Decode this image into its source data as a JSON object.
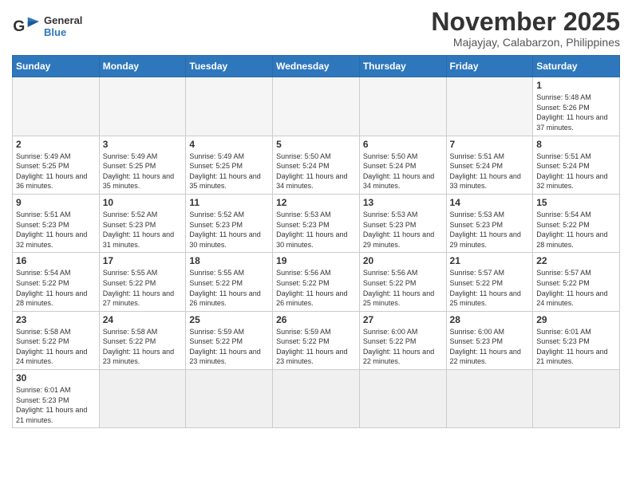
{
  "header": {
    "logo_line1": "General",
    "logo_line2": "Blue",
    "month_title": "November 2025",
    "location": "Majayjay, Calabarzon, Philippines"
  },
  "weekdays": [
    "Sunday",
    "Monday",
    "Tuesday",
    "Wednesday",
    "Thursday",
    "Friday",
    "Saturday"
  ],
  "weeks": [
    [
      {
        "day": null
      },
      {
        "day": null
      },
      {
        "day": null
      },
      {
        "day": null
      },
      {
        "day": null
      },
      {
        "day": null
      },
      {
        "day": 1,
        "sunrise": "5:48 AM",
        "sunset": "5:26 PM",
        "daylight": "11 hours and 37 minutes."
      }
    ],
    [
      {
        "day": 2,
        "sunrise": "5:49 AM",
        "sunset": "5:25 PM",
        "daylight": "11 hours and 36 minutes."
      },
      {
        "day": 3,
        "sunrise": "5:49 AM",
        "sunset": "5:25 PM",
        "daylight": "11 hours and 35 minutes."
      },
      {
        "day": 4,
        "sunrise": "5:49 AM",
        "sunset": "5:25 PM",
        "daylight": "11 hours and 35 minutes."
      },
      {
        "day": 5,
        "sunrise": "5:50 AM",
        "sunset": "5:24 PM",
        "daylight": "11 hours and 34 minutes."
      },
      {
        "day": 6,
        "sunrise": "5:50 AM",
        "sunset": "5:24 PM",
        "daylight": "11 hours and 34 minutes."
      },
      {
        "day": 7,
        "sunrise": "5:51 AM",
        "sunset": "5:24 PM",
        "daylight": "11 hours and 33 minutes."
      },
      {
        "day": 8,
        "sunrise": "5:51 AM",
        "sunset": "5:24 PM",
        "daylight": "11 hours and 32 minutes."
      }
    ],
    [
      {
        "day": 9,
        "sunrise": "5:51 AM",
        "sunset": "5:23 PM",
        "daylight": "11 hours and 32 minutes."
      },
      {
        "day": 10,
        "sunrise": "5:52 AM",
        "sunset": "5:23 PM",
        "daylight": "11 hours and 31 minutes."
      },
      {
        "day": 11,
        "sunrise": "5:52 AM",
        "sunset": "5:23 PM",
        "daylight": "11 hours and 30 minutes."
      },
      {
        "day": 12,
        "sunrise": "5:53 AM",
        "sunset": "5:23 PM",
        "daylight": "11 hours and 30 minutes."
      },
      {
        "day": 13,
        "sunrise": "5:53 AM",
        "sunset": "5:23 PM",
        "daylight": "11 hours and 29 minutes."
      },
      {
        "day": 14,
        "sunrise": "5:53 AM",
        "sunset": "5:23 PM",
        "daylight": "11 hours and 29 minutes."
      },
      {
        "day": 15,
        "sunrise": "5:54 AM",
        "sunset": "5:22 PM",
        "daylight": "11 hours and 28 minutes."
      }
    ],
    [
      {
        "day": 16,
        "sunrise": "5:54 AM",
        "sunset": "5:22 PM",
        "daylight": "11 hours and 28 minutes."
      },
      {
        "day": 17,
        "sunrise": "5:55 AM",
        "sunset": "5:22 PM",
        "daylight": "11 hours and 27 minutes."
      },
      {
        "day": 18,
        "sunrise": "5:55 AM",
        "sunset": "5:22 PM",
        "daylight": "11 hours and 26 minutes."
      },
      {
        "day": 19,
        "sunrise": "5:56 AM",
        "sunset": "5:22 PM",
        "daylight": "11 hours and 26 minutes."
      },
      {
        "day": 20,
        "sunrise": "5:56 AM",
        "sunset": "5:22 PM",
        "daylight": "11 hours and 25 minutes."
      },
      {
        "day": 21,
        "sunrise": "5:57 AM",
        "sunset": "5:22 PM",
        "daylight": "11 hours and 25 minutes."
      },
      {
        "day": 22,
        "sunrise": "5:57 AM",
        "sunset": "5:22 PM",
        "daylight": "11 hours and 24 minutes."
      }
    ],
    [
      {
        "day": 23,
        "sunrise": "5:58 AM",
        "sunset": "5:22 PM",
        "daylight": "11 hours and 24 minutes."
      },
      {
        "day": 24,
        "sunrise": "5:58 AM",
        "sunset": "5:22 PM",
        "daylight": "11 hours and 23 minutes."
      },
      {
        "day": 25,
        "sunrise": "5:59 AM",
        "sunset": "5:22 PM",
        "daylight": "11 hours and 23 minutes."
      },
      {
        "day": 26,
        "sunrise": "5:59 AM",
        "sunset": "5:22 PM",
        "daylight": "11 hours and 23 minutes."
      },
      {
        "day": 27,
        "sunrise": "6:00 AM",
        "sunset": "5:22 PM",
        "daylight": "11 hours and 22 minutes."
      },
      {
        "day": 28,
        "sunrise": "6:00 AM",
        "sunset": "5:23 PM",
        "daylight": "11 hours and 22 minutes."
      },
      {
        "day": 29,
        "sunrise": "6:01 AM",
        "sunset": "5:23 PM",
        "daylight": "11 hours and 21 minutes."
      }
    ],
    [
      {
        "day": 30,
        "sunrise": "6:01 AM",
        "sunset": "5:23 PM",
        "daylight": "11 hours and 21 minutes."
      },
      {
        "day": null
      },
      {
        "day": null
      },
      {
        "day": null
      },
      {
        "day": null
      },
      {
        "day": null
      },
      {
        "day": null
      }
    ]
  ]
}
